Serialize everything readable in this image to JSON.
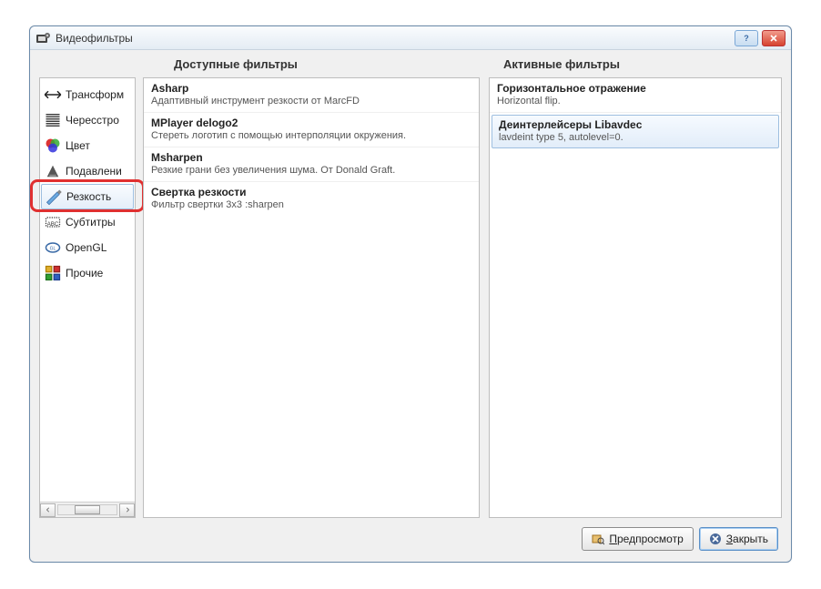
{
  "window": {
    "title": "Видеофильтры"
  },
  "headers": {
    "available": "Доступные фильтры",
    "active": "Активные фильтры"
  },
  "sidebar": {
    "items": [
      {
        "label": "Трансформ",
        "icon_name": "transform-icon"
      },
      {
        "label": "Чересстро",
        "icon_name": "interlace-icon"
      },
      {
        "label": "Цвет",
        "icon_name": "colors-icon"
      },
      {
        "label": "Подавлени",
        "icon_name": "noise-icon"
      },
      {
        "label": "Резкость",
        "icon_name": "sharpness-icon"
      },
      {
        "label": "Субтитры",
        "icon_name": "subtitles-icon"
      },
      {
        "label": "OpenGL",
        "icon_name": "opengl-icon"
      },
      {
        "label": "Прочие",
        "icon_name": "misc-icon"
      }
    ],
    "selected_index": 4
  },
  "available_filters": [
    {
      "name": "Asharp",
      "desc": "Адаптивный инструмент резкости от MarcFD"
    },
    {
      "name": "MPlayer delogo2",
      "desc": "Стереть логотип с помощью интерполяции окружения."
    },
    {
      "name": "Msharpen",
      "desc": "Резкие грани без увеличения шума. От Donald Graft."
    },
    {
      "name": "Свертка резкости",
      "desc": "Фильтр свертки 3x3 :sharpen"
    }
  ],
  "active_filters": [
    {
      "name": "Горизонтальное отражение",
      "desc": "Horizontal flip."
    },
    {
      "name": "Деинтерлейсеры Libavdec",
      "desc": "lavdeint type 5, autolevel=0."
    }
  ],
  "active_selected_index": 1,
  "buttons": {
    "preview": "Предпросмотр",
    "close": "Закрыть"
  }
}
